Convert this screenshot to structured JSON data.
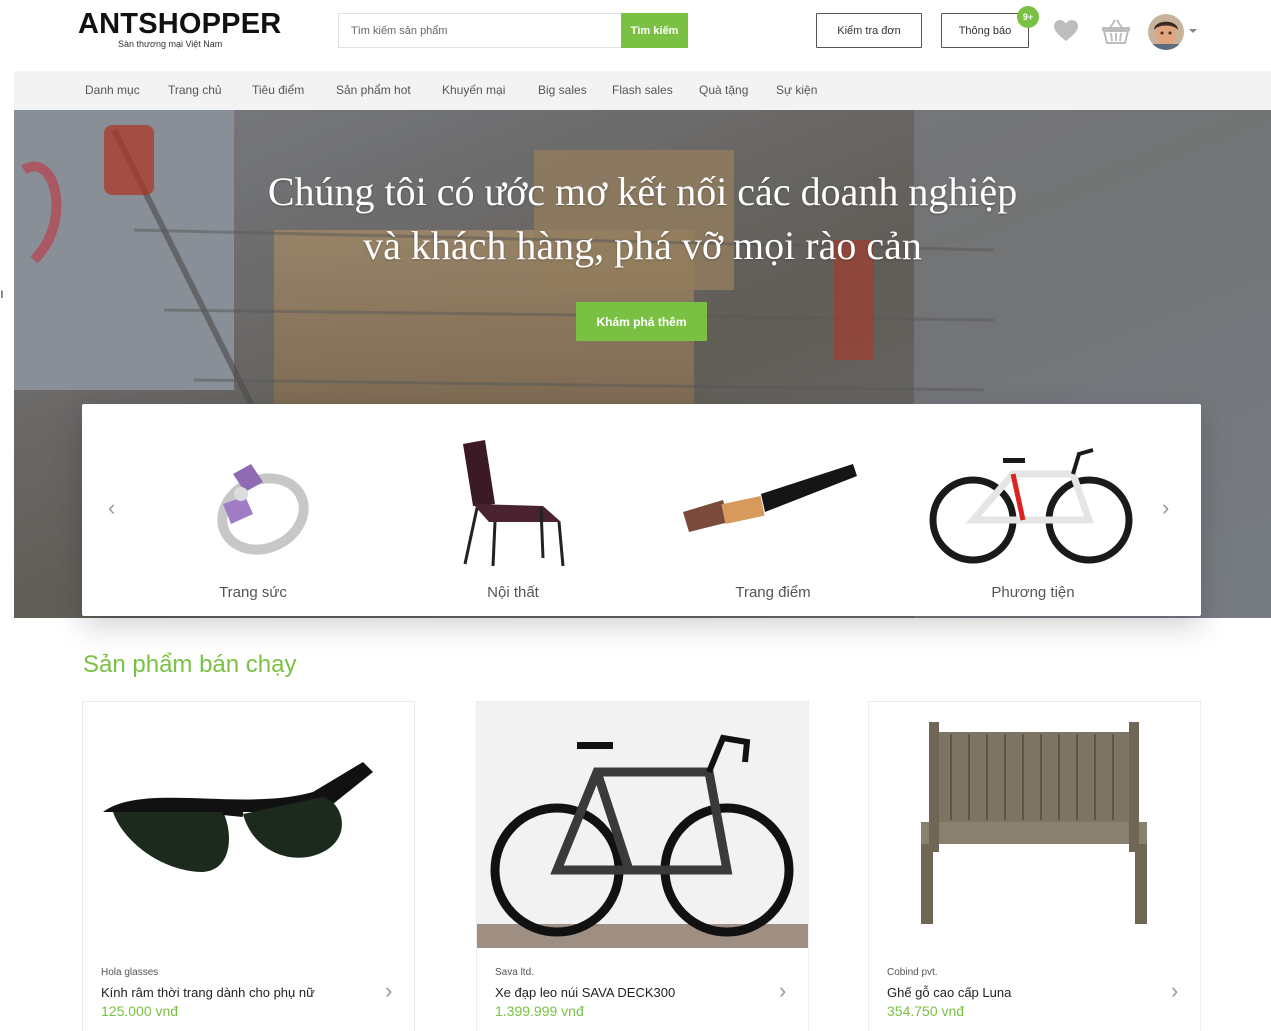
{
  "header": {
    "logo_title": "ANTSHOPPER",
    "logo_subtitle": "Sàn thương mại Việt Nam",
    "search_placeholder": "Tìm kiếm sản phẩm",
    "search_button": "Tìm kiếm",
    "order_button": "Kiểm tra đơn",
    "notification_button": "Thông báo",
    "notification_badge": "9+",
    "icons": [
      "heart-icon",
      "basket-icon",
      "avatar",
      "chevron-down-icon"
    ]
  },
  "nav": {
    "items": [
      {
        "label": "Danh mục"
      },
      {
        "label": "Trang chủ"
      },
      {
        "label": "Tiêu điểm"
      },
      {
        "label": "Sản phẩm hot"
      },
      {
        "label": "Khuyến mại"
      },
      {
        "label": "Big sales"
      },
      {
        "label": "Flash sales"
      },
      {
        "label": "Quà tặng"
      },
      {
        "label": "Sự kiện"
      }
    ]
  },
  "hero": {
    "title_line1": "Chúng tôi có ước mơ kết nối các doanh nghiệp",
    "title_line2": "và khách hàng, phá vỡ mọi rào cản",
    "cta_button": "Khám phá thêm"
  },
  "categories": {
    "prev_arrow": "‹",
    "next_arrow": "›",
    "items": [
      {
        "label": "Trang sức"
      },
      {
        "label": "Nội thất"
      },
      {
        "label": "Trang điểm"
      },
      {
        "label": "Phương tiện"
      }
    ]
  },
  "bestsellers": {
    "title": "Sản phẩm bán chạy",
    "products": [
      {
        "brand": "Hola glasses",
        "name": "Kính râm thời trang dành cho phụ nữ",
        "price": "125.000 vnđ"
      },
      {
        "brand": "Sava ltd.",
        "name": "Xe đạp leo núi SAVA DECK300",
        "price": "1.399.999 vnđ"
      },
      {
        "brand": "Cobind pvt.",
        "name": "Ghế gỗ cao cấp Luna",
        "price": "354.750 vnđ"
      }
    ]
  },
  "colors": {
    "accent": "#7ac143",
    "nav_bg": "#f3f3f3",
    "text": "#333333"
  }
}
